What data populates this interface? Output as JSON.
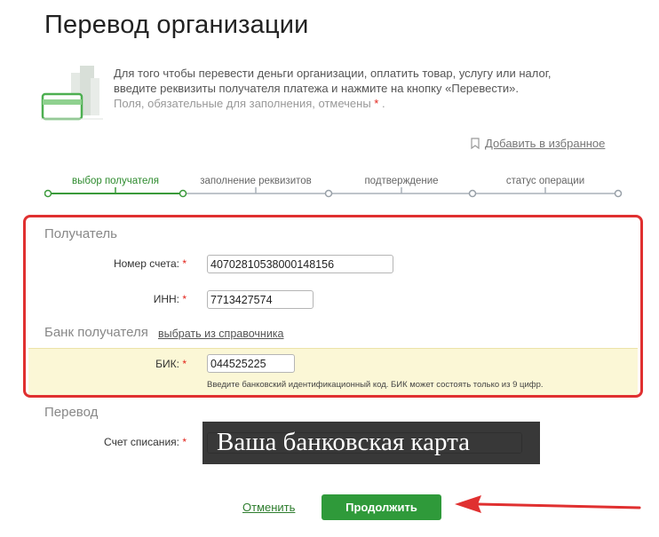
{
  "page": {
    "title": "Перевод организации",
    "info_line1": "Для того чтобы перевести деньги организации, оплатить товар, услугу или налог,",
    "info_line2": "введите реквизиты получателя платежа и нажмите на кнопку «Перевести».",
    "required_note": "Поля, обязательные для заполнения, отмечены",
    "required_mark": "*",
    "required_note_end": ".",
    "favorite_link": "Добавить в избранное"
  },
  "steps": [
    {
      "label": "выбор получателя",
      "active": true
    },
    {
      "label": "заполнение реквизитов",
      "active": false
    },
    {
      "label": "подтверждение",
      "active": false
    },
    {
      "label": "статус операции",
      "active": false
    }
  ],
  "recipient": {
    "section_title": "Получатель",
    "account_label": "Номер счета:",
    "account_value": "40702810538000148156",
    "inn_label": "ИНН:",
    "inn_value": "7713427574"
  },
  "bank": {
    "section_title": "Банк получателя",
    "dictionary_link": "выбрать из справочника",
    "bik_label": "БИК:",
    "bik_value": "044525225",
    "bik_hint": "Введите банковский идентификационный код. БИК может состоять только из 9 цифр."
  },
  "transfer": {
    "section_title": "Перевод",
    "debit_label": "Счет списания:"
  },
  "overlay_caption": "Ваша банковская карта",
  "actions": {
    "cancel": "Отменить",
    "continue": "Продолжить"
  },
  "colors": {
    "accent_green": "#2f9a3a",
    "highlight_red": "#e03030",
    "required_red": "#e2231a",
    "hint_band": "#fbf7d6"
  }
}
